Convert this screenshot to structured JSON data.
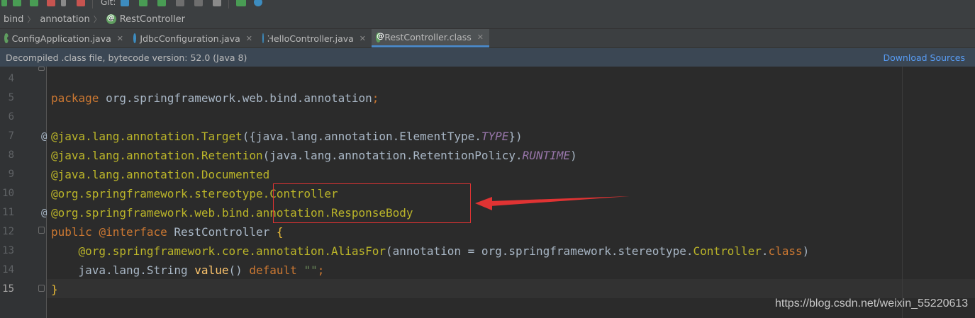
{
  "toolbar": {
    "git_label": "Git:"
  },
  "breadcrumb": [
    "bind",
    "annotation",
    "RestController"
  ],
  "tabs": [
    {
      "label": "ConfigApplication.java",
      "icon": "spring-icon",
      "active": false
    },
    {
      "label": "JdbcConfiguration.java",
      "icon": "class-icon",
      "active": false
    },
    {
      "label": "HelloController.java",
      "icon": "class-icon",
      "active": false
    },
    {
      "label": "RestController.class",
      "icon": "annotation-icon",
      "active": true
    }
  ],
  "banner": {
    "message": "Decompiled .class file, bytecode version: 52.0 (Java 8)",
    "action": "Download Sources"
  },
  "editor": {
    "line_numbers": [
      "4",
      "5",
      "6",
      "7",
      "8",
      "9",
      "10",
      "11",
      "12",
      "13",
      "14",
      "15"
    ],
    "current_line": "15",
    "lines": {
      "l5_kw": "package",
      "l5_rest": " org.springframework.web.bind.annotation",
      "l5_semi": ";",
      "l7_an": "@java.lang.annotation.",
      "l7_fn": "Target",
      "l7_mid": "({java.lang.annotation.ElementType.",
      "l7_it": "TYPE",
      "l7_end": "})",
      "l8_an": "@java.lang.annotation.",
      "l8_fn": "Retention",
      "l8_mid": "(java.lang.annotation.RetentionPolicy.",
      "l8_it": "RUNTIME",
      "l8_end": ")",
      "l9_an": "@java.lang.annotation.",
      "l9_fn": "Documented",
      "l10_an": "@org.springframework.stereotype.",
      "l10_fn": "Controller",
      "l11_an": "@org.springframework.web.bind.annotation.",
      "l11_fn": "ResponseBody",
      "l12_kw1": "public",
      "l12_kw2": "@interface",
      "l12_name": "RestController",
      "l12_brace": "{",
      "l13_indent": "    ",
      "l13_an": "@org.springframework.core.annotation.",
      "l13_fn": "AliasFor",
      "l13_mid": "(annotation = org.springframework.stereotype.",
      "l13_fn2": "Controller",
      "l13_dot": ".",
      "l13_kw": "class",
      "l13_end": ")",
      "l14_indent": "    ",
      "l14_type": "java.lang.String ",
      "l14_fn": "value",
      "l14_paren": "() ",
      "l14_kw": "default",
      "l14_str": "\"\"",
      "l14_semi": ";",
      "l15_brace": "}"
    }
  },
  "watermark": "https://blog.csdn.net/weixin_55220613",
  "colors": {
    "highlight": "#e03333",
    "keyword": "#cc7832",
    "annotation": "#bbb529",
    "constant": "#9876aa",
    "method": "#ffc66d",
    "string": "#6a8759"
  }
}
